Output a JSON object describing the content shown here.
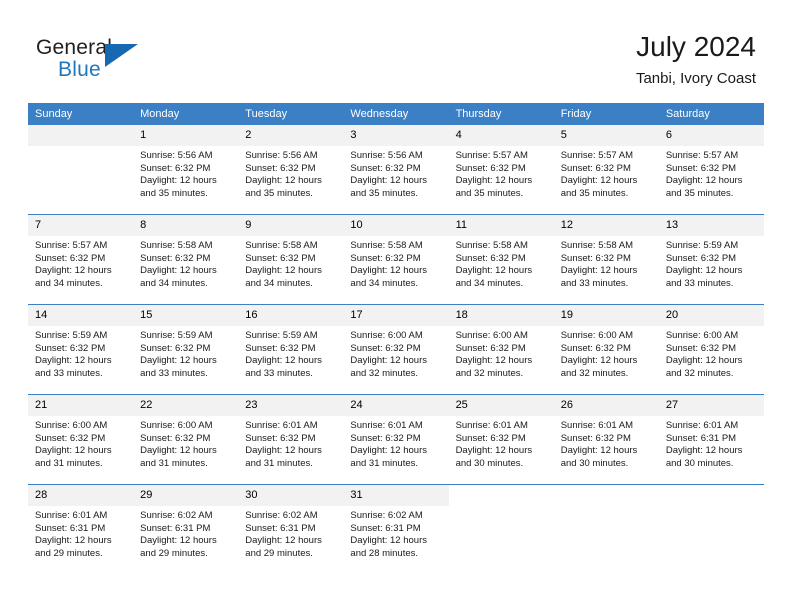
{
  "brand": {
    "word_one": "General",
    "word_two": "Blue",
    "color_black": "#231f20",
    "color_blue": "#1f77bd",
    "triangle_color": "#1669b0"
  },
  "header": {
    "title": "July 2024",
    "subtitle": "Tanbi, Ivory Coast"
  },
  "theme": {
    "header_blue": "#3b7fc4",
    "daynum_gray": "#f2f2f2",
    "text": "#1a1a1a"
  },
  "weekdays": [
    "Sunday",
    "Monday",
    "Tuesday",
    "Wednesday",
    "Thursday",
    "Friday",
    "Saturday"
  ],
  "labels": {
    "sunrise_prefix": "Sunrise:",
    "sunset_prefix": "Sunset:",
    "daylight_prefix": "Daylight:"
  },
  "weeks": [
    [
      {
        "day": "",
        "sunrise": "",
        "sunset": "",
        "daylight_line1": "",
        "daylight_line2": "",
        "empty": true
      },
      {
        "day": "1",
        "sunrise": "Sunrise: 5:56 AM",
        "sunset": "Sunset: 6:32 PM",
        "daylight_line1": "Daylight: 12 hours",
        "daylight_line2": "and 35 minutes."
      },
      {
        "day": "2",
        "sunrise": "Sunrise: 5:56 AM",
        "sunset": "Sunset: 6:32 PM",
        "daylight_line1": "Daylight: 12 hours",
        "daylight_line2": "and 35 minutes."
      },
      {
        "day": "3",
        "sunrise": "Sunrise: 5:56 AM",
        "sunset": "Sunset: 6:32 PM",
        "daylight_line1": "Daylight: 12 hours",
        "daylight_line2": "and 35 minutes."
      },
      {
        "day": "4",
        "sunrise": "Sunrise: 5:57 AM",
        "sunset": "Sunset: 6:32 PM",
        "daylight_line1": "Daylight: 12 hours",
        "daylight_line2": "and 35 minutes."
      },
      {
        "day": "5",
        "sunrise": "Sunrise: 5:57 AM",
        "sunset": "Sunset: 6:32 PM",
        "daylight_line1": "Daylight: 12 hours",
        "daylight_line2": "and 35 minutes."
      },
      {
        "day": "6",
        "sunrise": "Sunrise: 5:57 AM",
        "sunset": "Sunset: 6:32 PM",
        "daylight_line1": "Daylight: 12 hours",
        "daylight_line2": "and 35 minutes."
      }
    ],
    [
      {
        "day": "7",
        "sunrise": "Sunrise: 5:57 AM",
        "sunset": "Sunset: 6:32 PM",
        "daylight_line1": "Daylight: 12 hours",
        "daylight_line2": "and 34 minutes."
      },
      {
        "day": "8",
        "sunrise": "Sunrise: 5:58 AM",
        "sunset": "Sunset: 6:32 PM",
        "daylight_line1": "Daylight: 12 hours",
        "daylight_line2": "and 34 minutes."
      },
      {
        "day": "9",
        "sunrise": "Sunrise: 5:58 AM",
        "sunset": "Sunset: 6:32 PM",
        "daylight_line1": "Daylight: 12 hours",
        "daylight_line2": "and 34 minutes."
      },
      {
        "day": "10",
        "sunrise": "Sunrise: 5:58 AM",
        "sunset": "Sunset: 6:32 PM",
        "daylight_line1": "Daylight: 12 hours",
        "daylight_line2": "and 34 minutes."
      },
      {
        "day": "11",
        "sunrise": "Sunrise: 5:58 AM",
        "sunset": "Sunset: 6:32 PM",
        "daylight_line1": "Daylight: 12 hours",
        "daylight_line2": "and 34 minutes."
      },
      {
        "day": "12",
        "sunrise": "Sunrise: 5:58 AM",
        "sunset": "Sunset: 6:32 PM",
        "daylight_line1": "Daylight: 12 hours",
        "daylight_line2": "and 33 minutes."
      },
      {
        "day": "13",
        "sunrise": "Sunrise: 5:59 AM",
        "sunset": "Sunset: 6:32 PM",
        "daylight_line1": "Daylight: 12 hours",
        "daylight_line2": "and 33 minutes."
      }
    ],
    [
      {
        "day": "14",
        "sunrise": "Sunrise: 5:59 AM",
        "sunset": "Sunset: 6:32 PM",
        "daylight_line1": "Daylight: 12 hours",
        "daylight_line2": "and 33 minutes."
      },
      {
        "day": "15",
        "sunrise": "Sunrise: 5:59 AM",
        "sunset": "Sunset: 6:32 PM",
        "daylight_line1": "Daylight: 12 hours",
        "daylight_line2": "and 33 minutes."
      },
      {
        "day": "16",
        "sunrise": "Sunrise: 5:59 AM",
        "sunset": "Sunset: 6:32 PM",
        "daylight_line1": "Daylight: 12 hours",
        "daylight_line2": "and 33 minutes."
      },
      {
        "day": "17",
        "sunrise": "Sunrise: 6:00 AM",
        "sunset": "Sunset: 6:32 PM",
        "daylight_line1": "Daylight: 12 hours",
        "daylight_line2": "and 32 minutes."
      },
      {
        "day": "18",
        "sunrise": "Sunrise: 6:00 AM",
        "sunset": "Sunset: 6:32 PM",
        "daylight_line1": "Daylight: 12 hours",
        "daylight_line2": "and 32 minutes."
      },
      {
        "day": "19",
        "sunrise": "Sunrise: 6:00 AM",
        "sunset": "Sunset: 6:32 PM",
        "daylight_line1": "Daylight: 12 hours",
        "daylight_line2": "and 32 minutes."
      },
      {
        "day": "20",
        "sunrise": "Sunrise: 6:00 AM",
        "sunset": "Sunset: 6:32 PM",
        "daylight_line1": "Daylight: 12 hours",
        "daylight_line2": "and 32 minutes."
      }
    ],
    [
      {
        "day": "21",
        "sunrise": "Sunrise: 6:00 AM",
        "sunset": "Sunset: 6:32 PM",
        "daylight_line1": "Daylight: 12 hours",
        "daylight_line2": "and 31 minutes."
      },
      {
        "day": "22",
        "sunrise": "Sunrise: 6:00 AM",
        "sunset": "Sunset: 6:32 PM",
        "daylight_line1": "Daylight: 12 hours",
        "daylight_line2": "and 31 minutes."
      },
      {
        "day": "23",
        "sunrise": "Sunrise: 6:01 AM",
        "sunset": "Sunset: 6:32 PM",
        "daylight_line1": "Daylight: 12 hours",
        "daylight_line2": "and 31 minutes."
      },
      {
        "day": "24",
        "sunrise": "Sunrise: 6:01 AM",
        "sunset": "Sunset: 6:32 PM",
        "daylight_line1": "Daylight: 12 hours",
        "daylight_line2": "and 31 minutes."
      },
      {
        "day": "25",
        "sunrise": "Sunrise: 6:01 AM",
        "sunset": "Sunset: 6:32 PM",
        "daylight_line1": "Daylight: 12 hours",
        "daylight_line2": "and 30 minutes."
      },
      {
        "day": "26",
        "sunrise": "Sunrise: 6:01 AM",
        "sunset": "Sunset: 6:32 PM",
        "daylight_line1": "Daylight: 12 hours",
        "daylight_line2": "and 30 minutes."
      },
      {
        "day": "27",
        "sunrise": "Sunrise: 6:01 AM",
        "sunset": "Sunset: 6:31 PM",
        "daylight_line1": "Daylight: 12 hours",
        "daylight_line2": "and 30 minutes."
      }
    ],
    [
      {
        "day": "28",
        "sunrise": "Sunrise: 6:01 AM",
        "sunset": "Sunset: 6:31 PM",
        "daylight_line1": "Daylight: 12 hours",
        "daylight_line2": "and 29 minutes."
      },
      {
        "day": "29",
        "sunrise": "Sunrise: 6:02 AM",
        "sunset": "Sunset: 6:31 PM",
        "daylight_line1": "Daylight: 12 hours",
        "daylight_line2": "and 29 minutes."
      },
      {
        "day": "30",
        "sunrise": "Sunrise: 6:02 AM",
        "sunset": "Sunset: 6:31 PM",
        "daylight_line1": "Daylight: 12 hours",
        "daylight_line2": "and 29 minutes."
      },
      {
        "day": "31",
        "sunrise": "Sunrise: 6:02 AM",
        "sunset": "Sunset: 6:31 PM",
        "daylight_line1": "Daylight: 12 hours",
        "daylight_line2": "and 28 minutes."
      },
      {
        "day": "",
        "sunrise": "",
        "sunset": "",
        "daylight_line1": "",
        "daylight_line2": "",
        "blank": true
      },
      {
        "day": "",
        "sunrise": "",
        "sunset": "",
        "daylight_line1": "",
        "daylight_line2": "",
        "blank": true
      },
      {
        "day": "",
        "sunrise": "",
        "sunset": "",
        "daylight_line1": "",
        "daylight_line2": "",
        "blank": true
      }
    ]
  ]
}
